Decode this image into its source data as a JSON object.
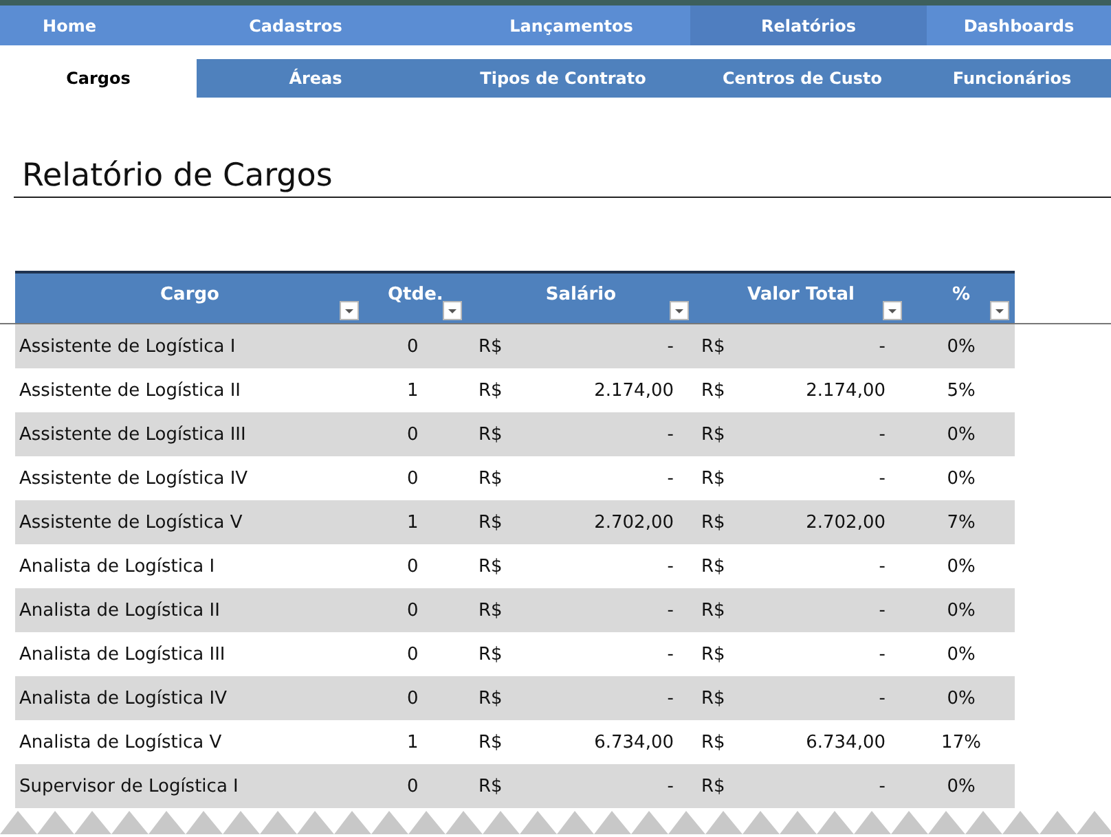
{
  "top_nav": [
    {
      "label": "Home",
      "selected": false
    },
    {
      "label": "Cadastros",
      "selected": false
    },
    {
      "label": "Lançamentos",
      "selected": false
    },
    {
      "label": "Relatórios",
      "selected": true
    },
    {
      "label": "Dashboards",
      "selected": false
    }
  ],
  "sub_nav": [
    {
      "label": "Cargos",
      "selected": true
    },
    {
      "label": "Áreas",
      "selected": false
    },
    {
      "label": "Tipos de Contrato",
      "selected": false
    },
    {
      "label": "Centros de Custo",
      "selected": false
    },
    {
      "label": "Funcionários",
      "selected": false
    }
  ],
  "report_title": "Relatório de Cargos",
  "table": {
    "columns": [
      "Cargo",
      "Qtde.",
      "Salário",
      "Valor Total",
      "%"
    ],
    "rows": [
      {
        "cargo": "Assistente de Logística I",
        "qtde": "0",
        "salario_currency": "R$",
        "salario": "-",
        "total_currency": "R$",
        "valor_total": "-",
        "percent": "0%"
      },
      {
        "cargo": "Assistente de Logística II",
        "qtde": "1",
        "salario_currency": "R$",
        "salario": "2.174,00",
        "total_currency": "R$",
        "valor_total": "2.174,00",
        "percent": "5%"
      },
      {
        "cargo": "Assistente de Logística III",
        "qtde": "0",
        "salario_currency": "R$",
        "salario": "-",
        "total_currency": "R$",
        "valor_total": "-",
        "percent": "0%"
      },
      {
        "cargo": "Assistente de Logística IV",
        "qtde": "0",
        "salario_currency": "R$",
        "salario": "-",
        "total_currency": "R$",
        "valor_total": "-",
        "percent": "0%"
      },
      {
        "cargo": "Assistente de Logística V",
        "qtde": "1",
        "salario_currency": "R$",
        "salario": "2.702,00",
        "total_currency": "R$",
        "valor_total": "2.702,00",
        "percent": "7%"
      },
      {
        "cargo": "Analista de Logística I",
        "qtde": "0",
        "salario_currency": "R$",
        "salario": "-",
        "total_currency": "R$",
        "valor_total": "-",
        "percent": "0%"
      },
      {
        "cargo": "Analista de Logística II",
        "qtde": "0",
        "salario_currency": "R$",
        "salario": "-",
        "total_currency": "R$",
        "valor_total": "-",
        "percent": "0%"
      },
      {
        "cargo": "Analista de Logística III",
        "qtde": "0",
        "salario_currency": "R$",
        "salario": "-",
        "total_currency": "R$",
        "valor_total": "-",
        "percent": "0%"
      },
      {
        "cargo": "Analista de Logística IV",
        "qtde": "0",
        "salario_currency": "R$",
        "salario": "-",
        "total_currency": "R$",
        "valor_total": "-",
        "percent": "0%"
      },
      {
        "cargo": "Analista de Logística V",
        "qtde": "1",
        "salario_currency": "R$",
        "salario": "6.734,00",
        "total_currency": "R$",
        "valor_total": "6.734,00",
        "percent": "17%"
      },
      {
        "cargo": "Supervisor de Logística I",
        "qtde": "0",
        "salario_currency": "R$",
        "salario": "-",
        "total_currency": "R$",
        "valor_total": "-",
        "percent": "0%"
      }
    ]
  }
}
